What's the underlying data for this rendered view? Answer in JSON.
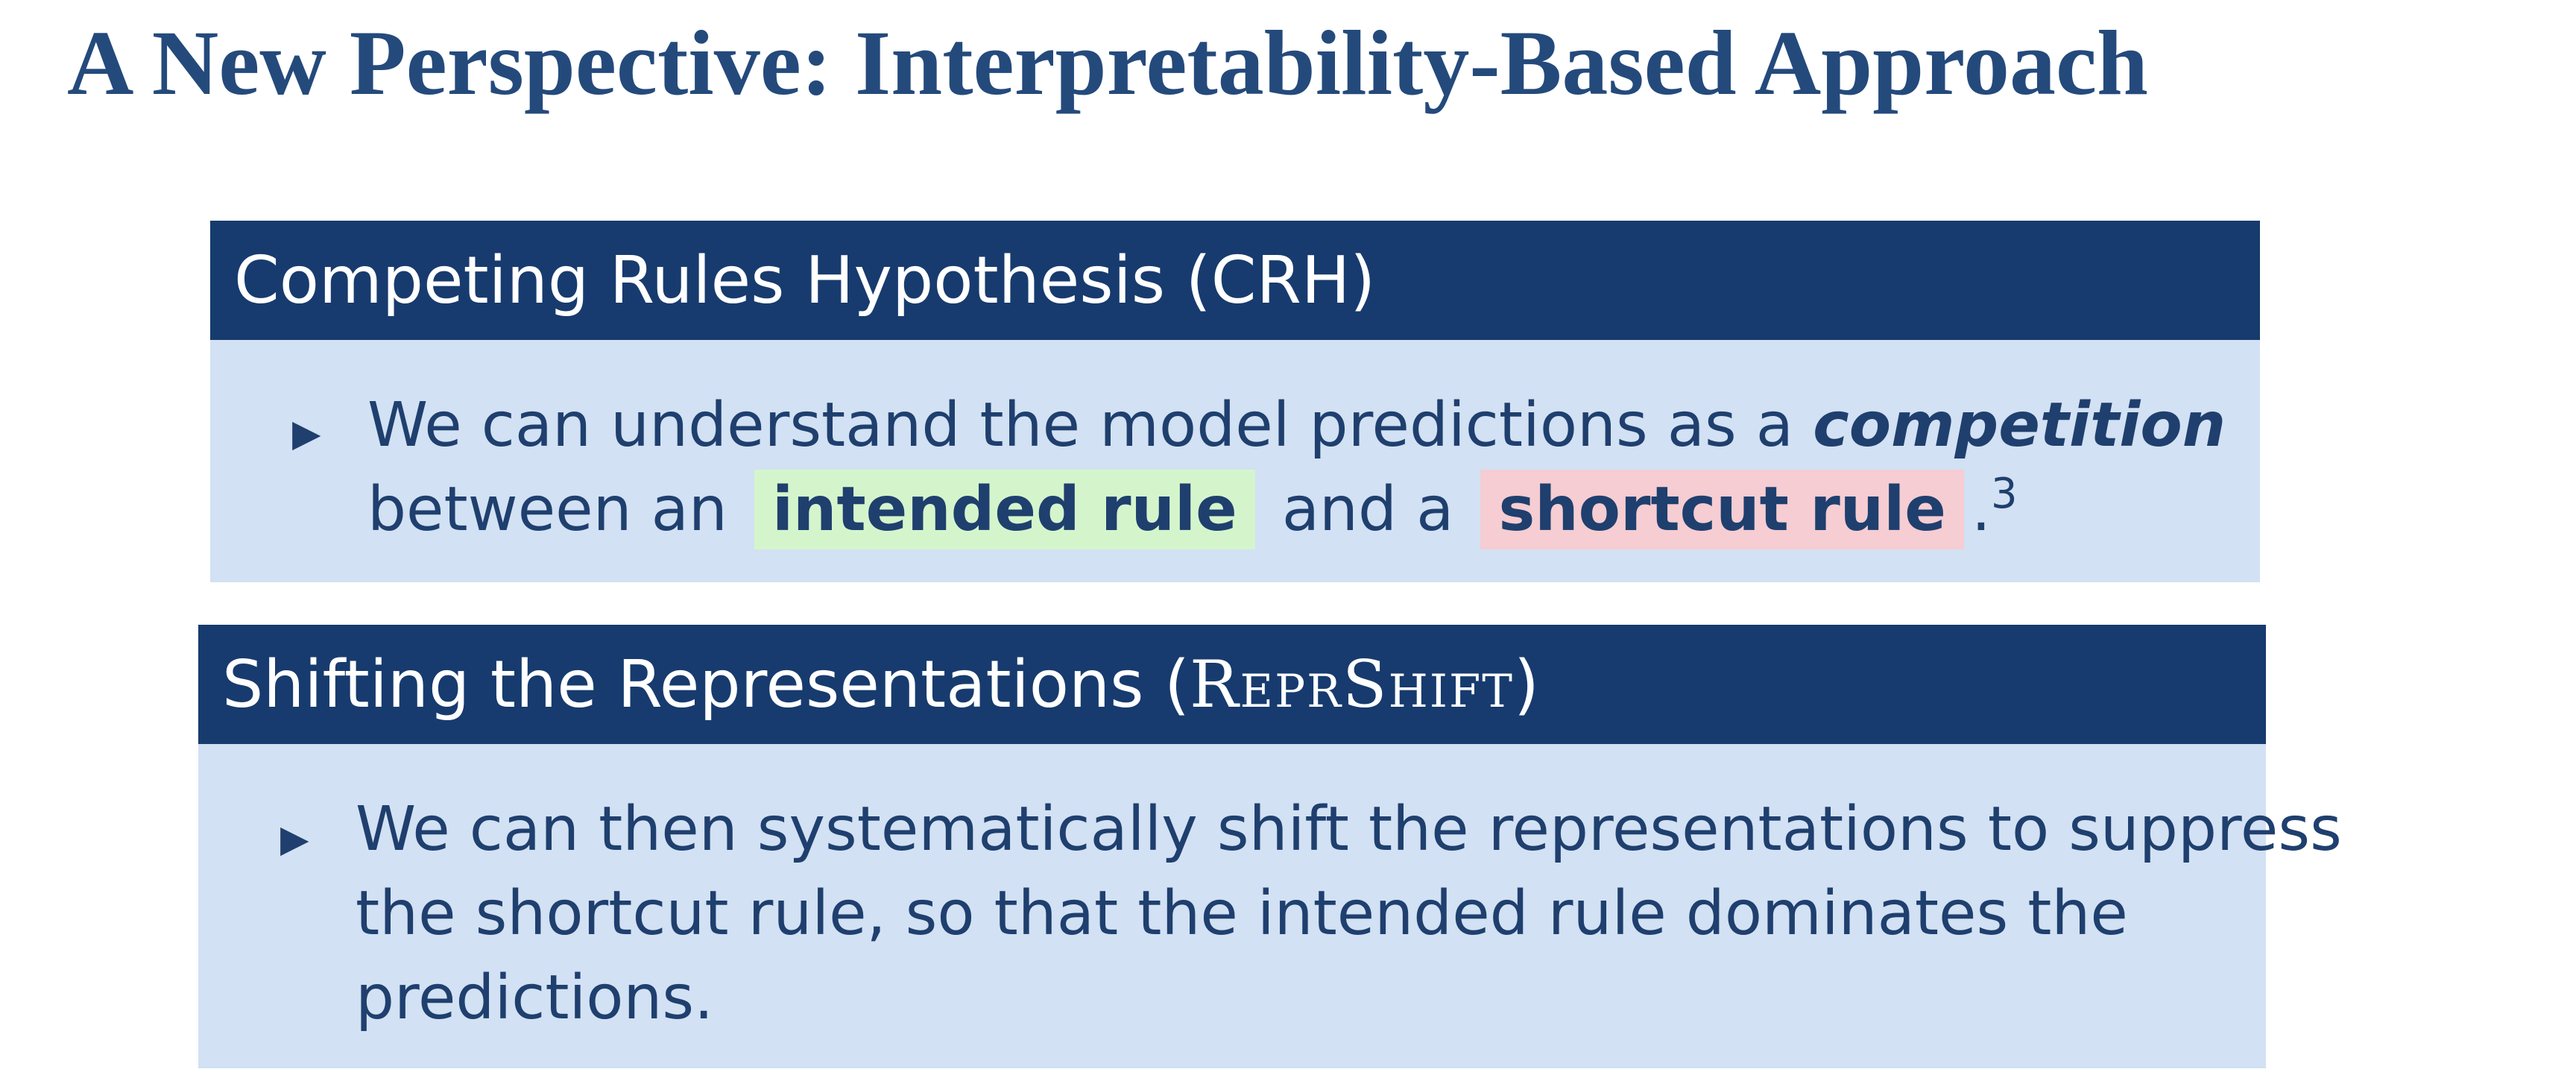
{
  "title": "A New Perspective: Interpretability-Based Approach",
  "block_crh": {
    "header": "Competing Rules Hypothesis (CRH)",
    "bullet_icon": "triangle-right-icon",
    "line1_text": "We can understand the model predictions as a",
    "line1_emphasis": "competition",
    "line2_prefix": "between an",
    "intended_rule": "intended rule",
    "line2_middle": "and a",
    "shortcut_rule": "shortcut rule",
    "line2_suffix": ".",
    "footnote_mark": "3",
    "colors": {
      "intended_highlight": "#d4f5cc",
      "shortcut_highlight": "#f5cdd2"
    }
  },
  "block_reprshift": {
    "header_prefix": "Shifting the Representations (",
    "header_method": "ReprShift",
    "header_suffix": ")",
    "bullet_icon": "triangle-right-icon",
    "line1": "We can then systematically shift the representations to suppress",
    "line2": "the shortcut rule, so that the intended rule dominates the",
    "line3": "predictions."
  },
  "colors": {
    "title": "#244a7c",
    "block_header": "#173b6e",
    "block_body": "#d2e1f3",
    "body_text": "#1f3f6e"
  }
}
